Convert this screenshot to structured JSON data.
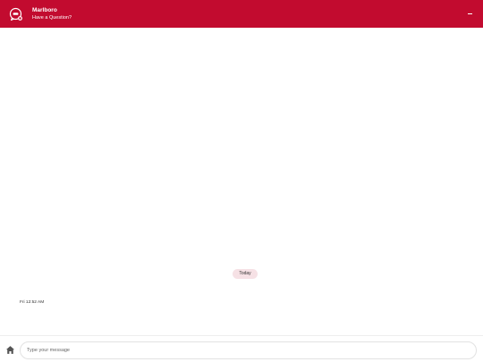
{
  "header": {
    "title": "Marlboro",
    "subtitle": "Have a Question?",
    "icon": "chat-bubble-icon",
    "minimize_icon": "minimize-icon"
  },
  "chat": {
    "date_separator": "Today",
    "message_timestamp": "Fri 12:52 AM"
  },
  "composer": {
    "home_icon": "home-icon",
    "placeholder": "Type your message",
    "value": ""
  },
  "colors": {
    "brand": "#c20b2f",
    "date_pill": "#f6e1e5",
    "home_icon": "#555555"
  }
}
